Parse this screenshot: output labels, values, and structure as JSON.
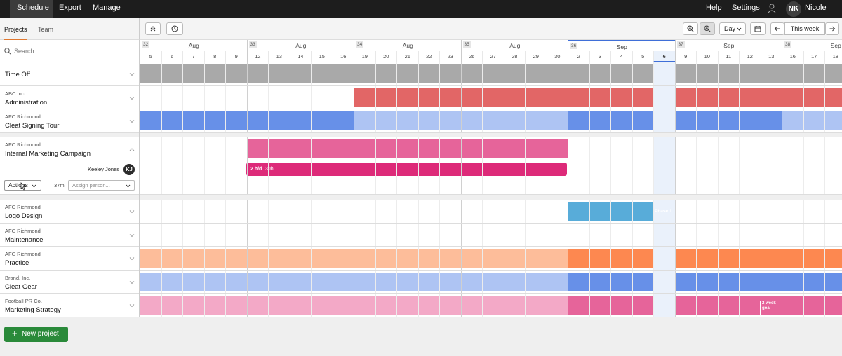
{
  "topnav": {
    "items": [
      {
        "label": "Schedule",
        "active": true
      },
      {
        "label": "Export",
        "active": false
      },
      {
        "label": "Manage",
        "active": false
      }
    ],
    "help_label": "Help",
    "settings_label": "Settings",
    "user_initials": "NK",
    "user_name": "Nicole"
  },
  "sidebar": {
    "tabs": [
      {
        "label": "Projects",
        "active": true
      },
      {
        "label": "Team",
        "active": false
      }
    ],
    "search_placeholder": "Search..."
  },
  "toolbar": {
    "view_label": "Day",
    "this_week_label": "This week"
  },
  "timeline": {
    "weeks": [
      {
        "num": "32",
        "month": "Aug"
      },
      {
        "num": "33",
        "month": "Aug"
      },
      {
        "num": "34",
        "month": "Aug"
      },
      {
        "num": "35",
        "month": "Aug"
      },
      {
        "num": "36",
        "month": "Sep"
      },
      {
        "num": "37",
        "month": "Sep"
      },
      {
        "num": "38",
        "month": "Sep"
      }
    ],
    "days": [
      "5",
      "6",
      "7",
      "8",
      "9",
      "12",
      "13",
      "14",
      "15",
      "16",
      "19",
      "20",
      "21",
      "22",
      "23",
      "26",
      "27",
      "28",
      "29",
      "30",
      "2",
      "3",
      "4",
      "5",
      "6",
      "9",
      "10",
      "11",
      "12",
      "13",
      "16",
      "17",
      "18"
    ],
    "today_index": 24
  },
  "projects": [
    {
      "client": "",
      "name": "Time Off"
    },
    {
      "client": "ABC Inc.",
      "name": "Administration"
    },
    {
      "client": "AFC Richmond",
      "name": "Cleat Signing Tour"
    },
    {
      "client": "AFC Richmond",
      "name": "Internal Marketing Campaign"
    },
    {
      "client": "AFC Richmond",
      "name": "Logo Design"
    },
    {
      "client": "AFC Richmond",
      "name": "Maintenance"
    },
    {
      "client": "AFC Richmond",
      "name": "Practice"
    },
    {
      "client": "Brand, Inc.",
      "name": "Cleat Gear"
    },
    {
      "client": "Football PR Co.",
      "name": "Marketing Strategy"
    }
  ],
  "expanded": {
    "person_name": "Keeley Jones",
    "person_initials": "KJ",
    "actions_label": "Actions",
    "duration": "37m",
    "assign_placeholder": "Assign person...",
    "allocation_label": "2 h/d",
    "allocation_total": "30h"
  },
  "bar_labels": {
    "phase": "Phase 1",
    "goal_line1": "2 week",
    "goal_line2": "goal"
  },
  "bars": [
    {
      "row": 0,
      "start": 0,
      "end": 33,
      "color": "#a9a9a9"
    },
    {
      "row": 1,
      "start": 10,
      "end": 33,
      "color": "#e26666"
    },
    {
      "row": 2,
      "start": 0,
      "end": 10,
      "color": "#6790e8"
    },
    {
      "row": 2,
      "start": 10,
      "end": 20,
      "color": "#aec4f3"
    },
    {
      "row": 2,
      "start": 20,
      "end": 30,
      "color": "#6790e8"
    },
    {
      "row": 2,
      "start": 30,
      "end": 33,
      "color": "#aec4f3"
    },
    {
      "row": 3,
      "start": 5,
      "end": 20,
      "color": "#e6649a"
    },
    {
      "row": 4,
      "start": 20,
      "end": 25,
      "color": "#58acd9"
    },
    {
      "row": 6,
      "start": 0,
      "end": 20,
      "color": "#fdbd9a"
    },
    {
      "row": 6,
      "start": 20,
      "end": 33,
      "color": "#fd8850"
    },
    {
      "row": 7,
      "start": 0,
      "end": 20,
      "color": "#aec4f3"
    },
    {
      "row": 7,
      "start": 20,
      "end": 33,
      "color": "#6790e8"
    },
    {
      "row": 8,
      "start": 0,
      "end": 20,
      "color": "#f3a9c7"
    },
    {
      "row": 8,
      "start": 20,
      "end": 33,
      "color": "#e6649a"
    }
  ],
  "colors": {
    "accent": "#e0782f",
    "new_project": "#2a8a3a",
    "allocation": "#dd2a79",
    "today_marker": "#3f6fd8"
  },
  "footer": {
    "new_project_label": "New project"
  }
}
